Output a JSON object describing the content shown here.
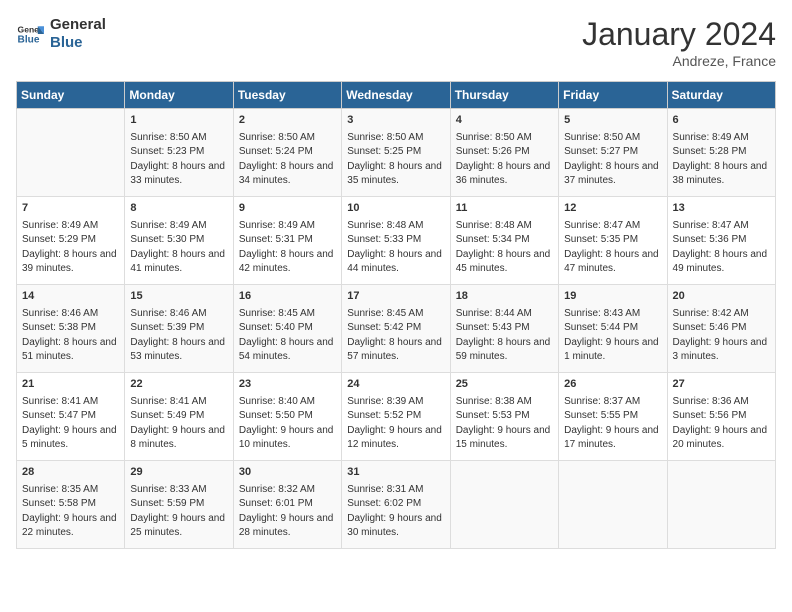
{
  "header": {
    "logo_line1": "General",
    "logo_line2": "Blue",
    "month": "January 2024",
    "location": "Andreze, France"
  },
  "weekdays": [
    "Sunday",
    "Monday",
    "Tuesday",
    "Wednesday",
    "Thursday",
    "Friday",
    "Saturday"
  ],
  "weeks": [
    [
      {
        "day": "",
        "sunrise": "",
        "sunset": "",
        "daylight": ""
      },
      {
        "day": "1",
        "sunrise": "Sunrise: 8:50 AM",
        "sunset": "Sunset: 5:23 PM",
        "daylight": "Daylight: 8 hours and 33 minutes."
      },
      {
        "day": "2",
        "sunrise": "Sunrise: 8:50 AM",
        "sunset": "Sunset: 5:24 PM",
        "daylight": "Daylight: 8 hours and 34 minutes."
      },
      {
        "day": "3",
        "sunrise": "Sunrise: 8:50 AM",
        "sunset": "Sunset: 5:25 PM",
        "daylight": "Daylight: 8 hours and 35 minutes."
      },
      {
        "day": "4",
        "sunrise": "Sunrise: 8:50 AM",
        "sunset": "Sunset: 5:26 PM",
        "daylight": "Daylight: 8 hours and 36 minutes."
      },
      {
        "day": "5",
        "sunrise": "Sunrise: 8:50 AM",
        "sunset": "Sunset: 5:27 PM",
        "daylight": "Daylight: 8 hours and 37 minutes."
      },
      {
        "day": "6",
        "sunrise": "Sunrise: 8:49 AM",
        "sunset": "Sunset: 5:28 PM",
        "daylight": "Daylight: 8 hours and 38 minutes."
      }
    ],
    [
      {
        "day": "7",
        "sunrise": "Sunrise: 8:49 AM",
        "sunset": "Sunset: 5:29 PM",
        "daylight": "Daylight: 8 hours and 39 minutes."
      },
      {
        "day": "8",
        "sunrise": "Sunrise: 8:49 AM",
        "sunset": "Sunset: 5:30 PM",
        "daylight": "Daylight: 8 hours and 41 minutes."
      },
      {
        "day": "9",
        "sunrise": "Sunrise: 8:49 AM",
        "sunset": "Sunset: 5:31 PM",
        "daylight": "Daylight: 8 hours and 42 minutes."
      },
      {
        "day": "10",
        "sunrise": "Sunrise: 8:48 AM",
        "sunset": "Sunset: 5:33 PM",
        "daylight": "Daylight: 8 hours and 44 minutes."
      },
      {
        "day": "11",
        "sunrise": "Sunrise: 8:48 AM",
        "sunset": "Sunset: 5:34 PM",
        "daylight": "Daylight: 8 hours and 45 minutes."
      },
      {
        "day": "12",
        "sunrise": "Sunrise: 8:47 AM",
        "sunset": "Sunset: 5:35 PM",
        "daylight": "Daylight: 8 hours and 47 minutes."
      },
      {
        "day": "13",
        "sunrise": "Sunrise: 8:47 AM",
        "sunset": "Sunset: 5:36 PM",
        "daylight": "Daylight: 8 hours and 49 minutes."
      }
    ],
    [
      {
        "day": "14",
        "sunrise": "Sunrise: 8:46 AM",
        "sunset": "Sunset: 5:38 PM",
        "daylight": "Daylight: 8 hours and 51 minutes."
      },
      {
        "day": "15",
        "sunrise": "Sunrise: 8:46 AM",
        "sunset": "Sunset: 5:39 PM",
        "daylight": "Daylight: 8 hours and 53 minutes."
      },
      {
        "day": "16",
        "sunrise": "Sunrise: 8:45 AM",
        "sunset": "Sunset: 5:40 PM",
        "daylight": "Daylight: 8 hours and 54 minutes."
      },
      {
        "day": "17",
        "sunrise": "Sunrise: 8:45 AM",
        "sunset": "Sunset: 5:42 PM",
        "daylight": "Daylight: 8 hours and 57 minutes."
      },
      {
        "day": "18",
        "sunrise": "Sunrise: 8:44 AM",
        "sunset": "Sunset: 5:43 PM",
        "daylight": "Daylight: 8 hours and 59 minutes."
      },
      {
        "day": "19",
        "sunrise": "Sunrise: 8:43 AM",
        "sunset": "Sunset: 5:44 PM",
        "daylight": "Daylight: 9 hours and 1 minute."
      },
      {
        "day": "20",
        "sunrise": "Sunrise: 8:42 AM",
        "sunset": "Sunset: 5:46 PM",
        "daylight": "Daylight: 9 hours and 3 minutes."
      }
    ],
    [
      {
        "day": "21",
        "sunrise": "Sunrise: 8:41 AM",
        "sunset": "Sunset: 5:47 PM",
        "daylight": "Daylight: 9 hours and 5 minutes."
      },
      {
        "day": "22",
        "sunrise": "Sunrise: 8:41 AM",
        "sunset": "Sunset: 5:49 PM",
        "daylight": "Daylight: 9 hours and 8 minutes."
      },
      {
        "day": "23",
        "sunrise": "Sunrise: 8:40 AM",
        "sunset": "Sunset: 5:50 PM",
        "daylight": "Daylight: 9 hours and 10 minutes."
      },
      {
        "day": "24",
        "sunrise": "Sunrise: 8:39 AM",
        "sunset": "Sunset: 5:52 PM",
        "daylight": "Daylight: 9 hours and 12 minutes."
      },
      {
        "day": "25",
        "sunrise": "Sunrise: 8:38 AM",
        "sunset": "Sunset: 5:53 PM",
        "daylight": "Daylight: 9 hours and 15 minutes."
      },
      {
        "day": "26",
        "sunrise": "Sunrise: 8:37 AM",
        "sunset": "Sunset: 5:55 PM",
        "daylight": "Daylight: 9 hours and 17 minutes."
      },
      {
        "day": "27",
        "sunrise": "Sunrise: 8:36 AM",
        "sunset": "Sunset: 5:56 PM",
        "daylight": "Daylight: 9 hours and 20 minutes."
      }
    ],
    [
      {
        "day": "28",
        "sunrise": "Sunrise: 8:35 AM",
        "sunset": "Sunset: 5:58 PM",
        "daylight": "Daylight: 9 hours and 22 minutes."
      },
      {
        "day": "29",
        "sunrise": "Sunrise: 8:33 AM",
        "sunset": "Sunset: 5:59 PM",
        "daylight": "Daylight: 9 hours and 25 minutes."
      },
      {
        "day": "30",
        "sunrise": "Sunrise: 8:32 AM",
        "sunset": "Sunset: 6:01 PM",
        "daylight": "Daylight: 9 hours and 28 minutes."
      },
      {
        "day": "31",
        "sunrise": "Sunrise: 8:31 AM",
        "sunset": "Sunset: 6:02 PM",
        "daylight": "Daylight: 9 hours and 30 minutes."
      },
      {
        "day": "",
        "sunrise": "",
        "sunset": "",
        "daylight": ""
      },
      {
        "day": "",
        "sunrise": "",
        "sunset": "",
        "daylight": ""
      },
      {
        "day": "",
        "sunrise": "",
        "sunset": "",
        "daylight": ""
      }
    ]
  ]
}
